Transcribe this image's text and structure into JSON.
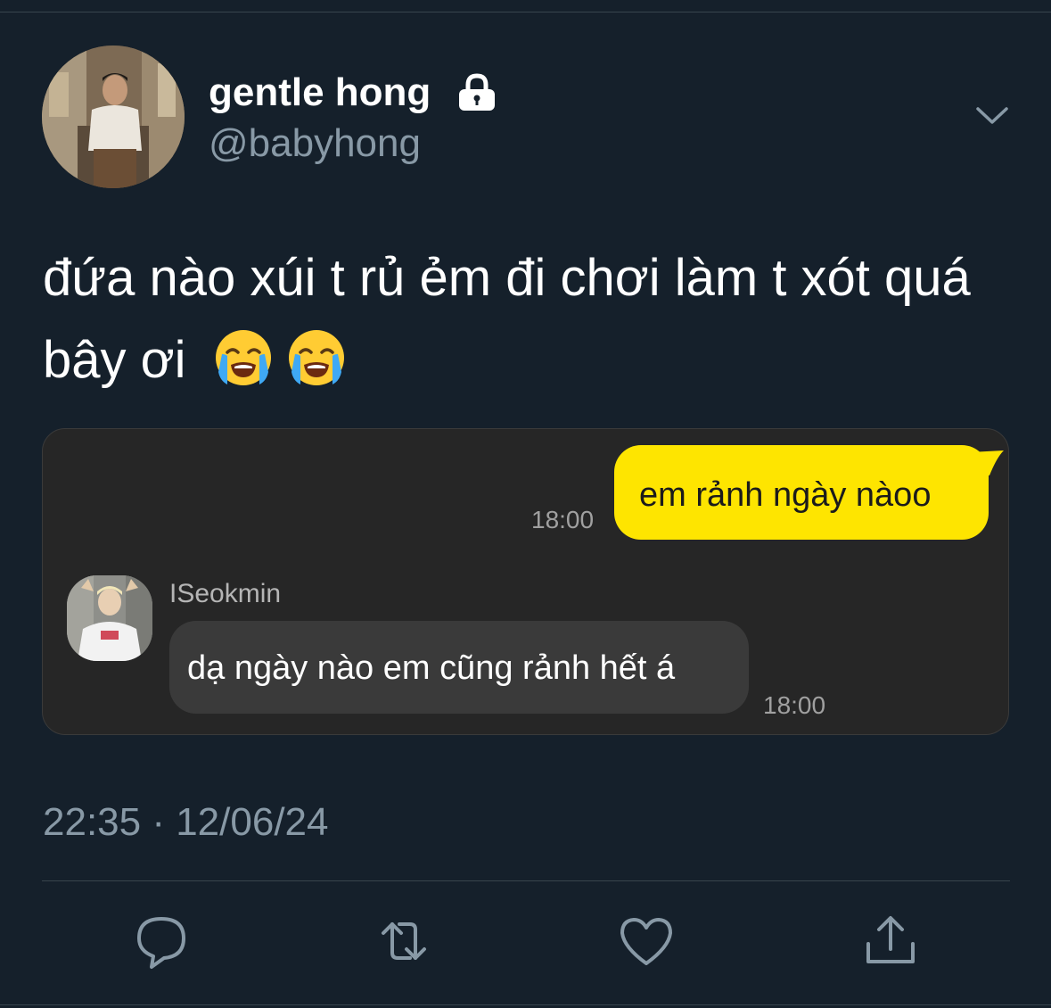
{
  "colors": {
    "background": "#15202b",
    "secondary_text": "#8899a6",
    "divider": "#38444d",
    "chat_background": "#262626",
    "sent_bubble": "#fee500",
    "received_bubble": "#3a3a3a"
  },
  "tweet": {
    "display_name": "gentle hong",
    "handle": "@babyhong",
    "text": "đứa nào xúi t rủ ẻm đi chơi làm t xót quá bây ơi",
    "emojis": [
      "loudly-crying-face-icon",
      "loudly-crying-face-icon"
    ],
    "timestamp": "22:35 · 12/06/24"
  },
  "chat": {
    "sent_message": {
      "text": "em rảnh ngày nàoo",
      "time": "18:00"
    },
    "received_message": {
      "sender": "ISeokmin",
      "text": "dạ ngày nào em cũng rảnh hết á",
      "time": "18:00"
    }
  },
  "actions": [
    {
      "icon": "reply-icon"
    },
    {
      "icon": "retweet-icon"
    },
    {
      "icon": "like-icon"
    },
    {
      "icon": "share-icon"
    }
  ]
}
